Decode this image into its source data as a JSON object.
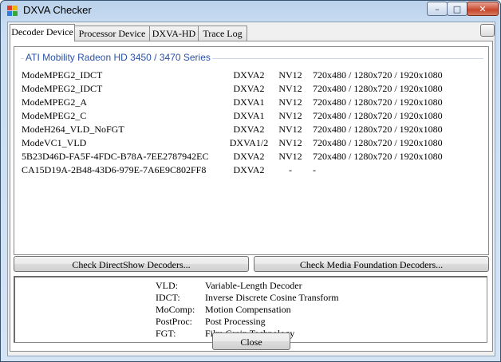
{
  "window": {
    "title": "DXVA Checker"
  },
  "caption_buttons": {
    "minimize": "–",
    "maximize": "□",
    "close": "✕"
  },
  "tabs": [
    {
      "label": "Decoder Device",
      "active": true
    },
    {
      "label": "Processor Device",
      "active": false
    },
    {
      "label": "DXVA-HD",
      "active": false
    },
    {
      "label": "Trace Log",
      "active": false
    }
  ],
  "device_group": {
    "name": "ATI Mobility Radeon HD 3450 / 3470 Series"
  },
  "decoders": [
    {
      "name": "ModeMPEG2_IDCT",
      "api": "DXVA2",
      "format": "NV12",
      "resolutions": "720x480 / 1280x720 / 1920x1080"
    },
    {
      "name": "ModeMPEG2_IDCT",
      "api": "DXVA2",
      "format": "NV12",
      "resolutions": "720x480 / 1280x720 / 1920x1080"
    },
    {
      "name": "ModeMPEG2_A",
      "api": "DXVA1",
      "format": "NV12",
      "resolutions": "720x480 / 1280x720 / 1920x1080"
    },
    {
      "name": "ModeMPEG2_C",
      "api": "DXVA1",
      "format": "NV12",
      "resolutions": "720x480 / 1280x720 / 1920x1080"
    },
    {
      "name": "ModeH264_VLD_NoFGT",
      "api": "DXVA2",
      "format": "NV12",
      "resolutions": "720x480 / 1280x720 / 1920x1080"
    },
    {
      "name": "ModeVC1_VLD",
      "api": "DXVA1/2",
      "format": "NV12",
      "resolutions": "720x480 / 1280x720 / 1920x1080"
    },
    {
      "name": "5B23D46D-FA5F-4FDC-B78A-7EE2787942EC",
      "api": "DXVA2",
      "format": "NV12",
      "resolutions": "720x480 / 1280x720 / 1920x1080"
    },
    {
      "name": "CA15D19A-2B48-43D6-979E-7A6E9C802FF8",
      "api": "DXVA2",
      "format": "-",
      "resolutions": "-"
    }
  ],
  "buttons": {
    "check_directshow": "Check DirectShow Decoders...",
    "check_media_foundation": "Check Media Foundation Decoders...",
    "close": "Close"
  },
  "legend": [
    {
      "abbr": "VLD:",
      "desc": "Variable-Length Decoder"
    },
    {
      "abbr": "IDCT:",
      "desc": "Inverse Discrete Cosine Transform"
    },
    {
      "abbr": "MoComp:",
      "desc": "Motion Compensation"
    },
    {
      "abbr": "PostProc:",
      "desc": "Post Processing"
    },
    {
      "abbr": "FGT:",
      "desc": "Film Grain Technology"
    }
  ]
}
